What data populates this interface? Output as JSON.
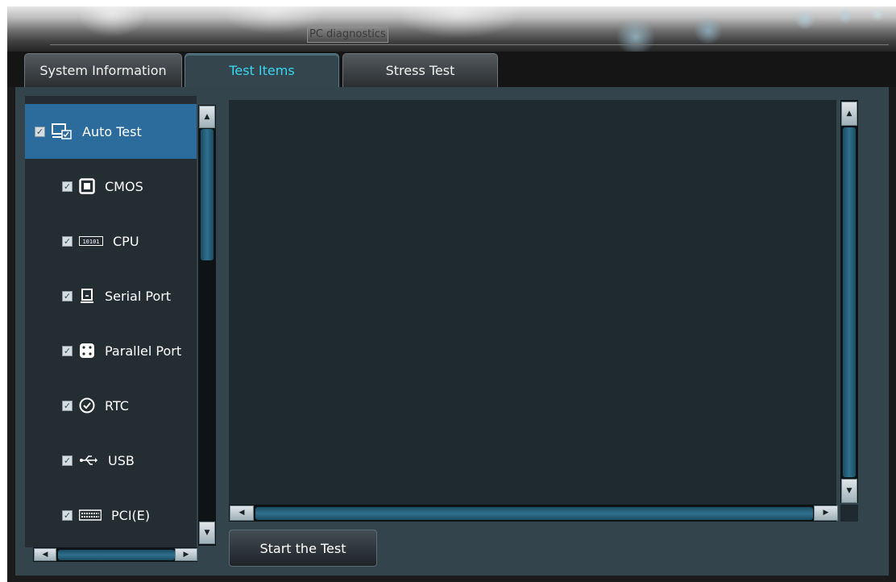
{
  "window": {
    "title": "PC diagnostics"
  },
  "tabs": [
    {
      "label": "System Information",
      "active": false
    },
    {
      "label": "Test Items",
      "active": true
    },
    {
      "label": "Stress Test",
      "active": false
    }
  ],
  "test_items": [
    {
      "label": "Auto Test",
      "checked": true,
      "icon": "monitor-check-icon",
      "selected": true
    },
    {
      "label": "CMOS",
      "checked": true,
      "icon": "chip-icon"
    },
    {
      "label": "CPU",
      "checked": true,
      "icon": "binary-bar-icon"
    },
    {
      "label": "Serial Port",
      "checked": true,
      "icon": "serial-port-icon"
    },
    {
      "label": "Parallel Port",
      "checked": true,
      "icon": "parallel-port-icon"
    },
    {
      "label": "RTC",
      "checked": true,
      "icon": "clock-icon"
    },
    {
      "label": "USB",
      "checked": true,
      "icon": "usb-icon"
    },
    {
      "label": "PCI(E)",
      "checked": true,
      "icon": "pci-slot-icon"
    }
  ],
  "actions": {
    "start_label": "Start the Test"
  },
  "colors": {
    "selected_item": "#2b6c9d",
    "active_tab_text": "#38d7f0",
    "panel_bg": "#34444d",
    "list_bg": "#232d32",
    "output_bg": "#1f2a30"
  }
}
